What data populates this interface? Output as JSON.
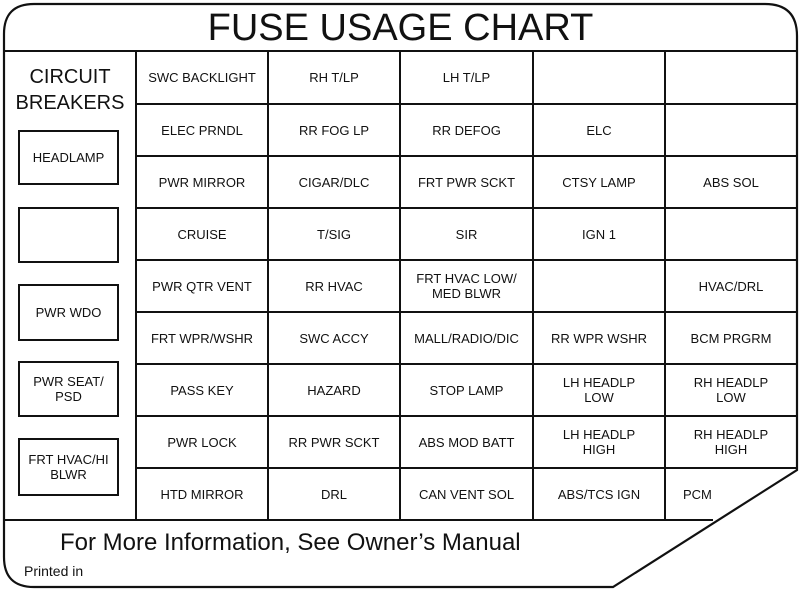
{
  "title": "FUSE USAGE CHART",
  "circuit_breakers": {
    "heading_line1": "CIRCUIT",
    "heading_line2": "BREAKERS",
    "items": [
      {
        "label": "HEADLAMP"
      },
      {
        "label": ""
      },
      {
        "label": "PWR WDO"
      },
      {
        "label": "PWR SEAT/\nPSD"
      },
      {
        "label": "FRT HVAC/HI\nBLWR"
      }
    ]
  },
  "fuses": {
    "rows": [
      [
        "SWC BACKLIGHT",
        "RH T/LP",
        "LH T/LP",
        "",
        ""
      ],
      [
        "ELEC PRNDL",
        "RR FOG LP",
        "RR DEFOG",
        "ELC",
        ""
      ],
      [
        "PWR MIRROR",
        "CIGAR/DLC",
        "FRT PWR SCKT",
        "CTSY LAMP",
        "ABS SOL"
      ],
      [
        "CRUISE",
        "T/SIG",
        "SIR",
        "IGN 1",
        ""
      ],
      [
        "PWR QTR VENT",
        "RR HVAC",
        "FRT HVAC LOW/\nMED BLWR",
        "",
        "HVAC/DRL"
      ],
      [
        "FRT WPR/WSHR",
        "SWC ACCY",
        "MALL/RADIO/DIC",
        "RR WPR WSHR",
        "BCM PRGRM"
      ],
      [
        "PASS KEY",
        "HAZARD",
        "STOP LAMP",
        "LH HEADLP\nLOW",
        "RH HEADLP\nLOW"
      ],
      [
        "PWR LOCK",
        "RR PWR SCKT",
        "ABS MOD BATT",
        "LH HEADLP\nHIGH",
        "RH HEADLP\nHIGH"
      ],
      [
        "HTD MIRROR",
        "DRL",
        "CAN VENT SOL",
        "ABS/TCS IGN",
        "PCM"
      ]
    ]
  },
  "footer": {
    "note": "For More Information, See Owner’s Manual",
    "printed": "Printed in"
  },
  "colors": {
    "line": "#111111",
    "background": "#ffffff"
  }
}
